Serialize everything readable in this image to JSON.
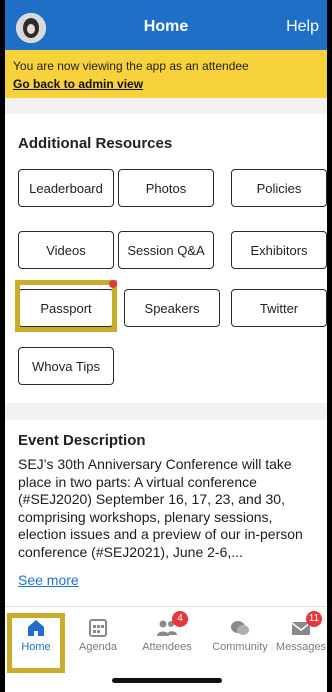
{
  "header": {
    "title": "Home",
    "help_label": "Help"
  },
  "banner": {
    "message": "You are now viewing the app as an attendee",
    "link": "Go back to admin view"
  },
  "resources": {
    "title": "Additional Resources",
    "buttons": [
      "Leaderboard",
      "Photos",
      "Policies",
      "Videos",
      "Session Q&A",
      "Exhibitors",
      "Passport",
      "Speakers",
      "Twitter",
      "Whova Tips"
    ]
  },
  "description": {
    "title": "Event Description",
    "text": "SEJ’s 30th Anniversary Conference will take place in two parts: A virtual conference (#SEJ2020) September 16, 17, 23, and 30, comprising workshops, plenary sessions, election issues and a preview of our in-person conference (#SEJ2021), June 2-6,...",
    "see_more": "See more"
  },
  "nav": {
    "items": [
      {
        "label": "Home",
        "icon": "home-icon",
        "active": true
      },
      {
        "label": "Agenda",
        "icon": "calendar-icon"
      },
      {
        "label": "Attendees",
        "icon": "people-icon",
        "badge": "4"
      },
      {
        "label": "Community",
        "icon": "chat-bubbles-icon"
      },
      {
        "label": "Messages",
        "icon": "envelope-icon",
        "badge": "11"
      }
    ]
  },
  "colors": {
    "header": "#1f6fc7",
    "banner": "#f8d23a",
    "highlight": "#c9ad2a",
    "badge": "#e5383b"
  }
}
